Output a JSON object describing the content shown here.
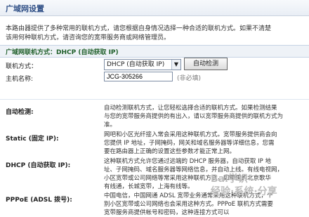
{
  "header": {
    "title": "广域网设置"
  },
  "intro": {
    "line1": "本路由器提供了多种常用的联机方式，请您根据自身情况选择一种合适的联机方式。如果不清楚",
    "line2": "该用何种联机方式，请咨询您的宽带服务商或网络管理员。"
  },
  "wan": {
    "section_title": "广域网联机方式：DHCP (自动获取 IP)",
    "mode_label": "联机方式：",
    "mode_value": "DHCP (自动获取 IP)",
    "detect_button": "自动检测",
    "hostname_label": "主机名称:",
    "hostname_value": "JCG-305266",
    "hostname_hint": "(非必填)"
  },
  "help": {
    "auto_title": "自动检测:",
    "auto_l1": "自动检测联机方式，让您轻松选择合适的联机方式。如果检测结果",
    "auto_l2": "与您的宽带服务商提供的有出入，请以宽带服务商提供的联机方式为",
    "auto_l3": "准。",
    "static_title": "Static (固定 IP):",
    "static_l1": "网吧和小区光纤接入常会采用这种联机方式。宽带服务提供商会向",
    "static_l2": "您提供 IP 地址，子网掩码，网关和域名服务器等详细信息，您需",
    "static_l3": "要在路由器上正确的设置这些参数才能正常上网。",
    "dhcp_title": "DHCP (自动获取 IP):",
    "dhcp_l1": "这种联机方式允许您通过远端的 DHCP 服务器，自动获取 IP 地",
    "dhcp_l2": "址、子网掩码、域名服务器等网络信息，并自动上线。有线电视网，",
    "dhcp_l3": "小区宽带或公司网络等常采用这种联机方式，如中国的北京歌华",
    "dhcp_l4": "有线通，长城宽带，上海有线等。",
    "pppoe_title": "PPPoE (ADSL 拨号):",
    "pppoe_l1": "中国电信，中国网通 ADSL 宽带业务通常采用这种联机方式，个",
    "pppoe_l2": "别小区宽带或公司网络也会采用这种方式。PPPoE 联机方式需要",
    "pppoe_l3": "宽带服务商提供帐号和密码，这种连接方式可以"
  },
  "watermark": {
    "line1": "Bai学识",
    "line2": "经验·系统·分享"
  }
}
